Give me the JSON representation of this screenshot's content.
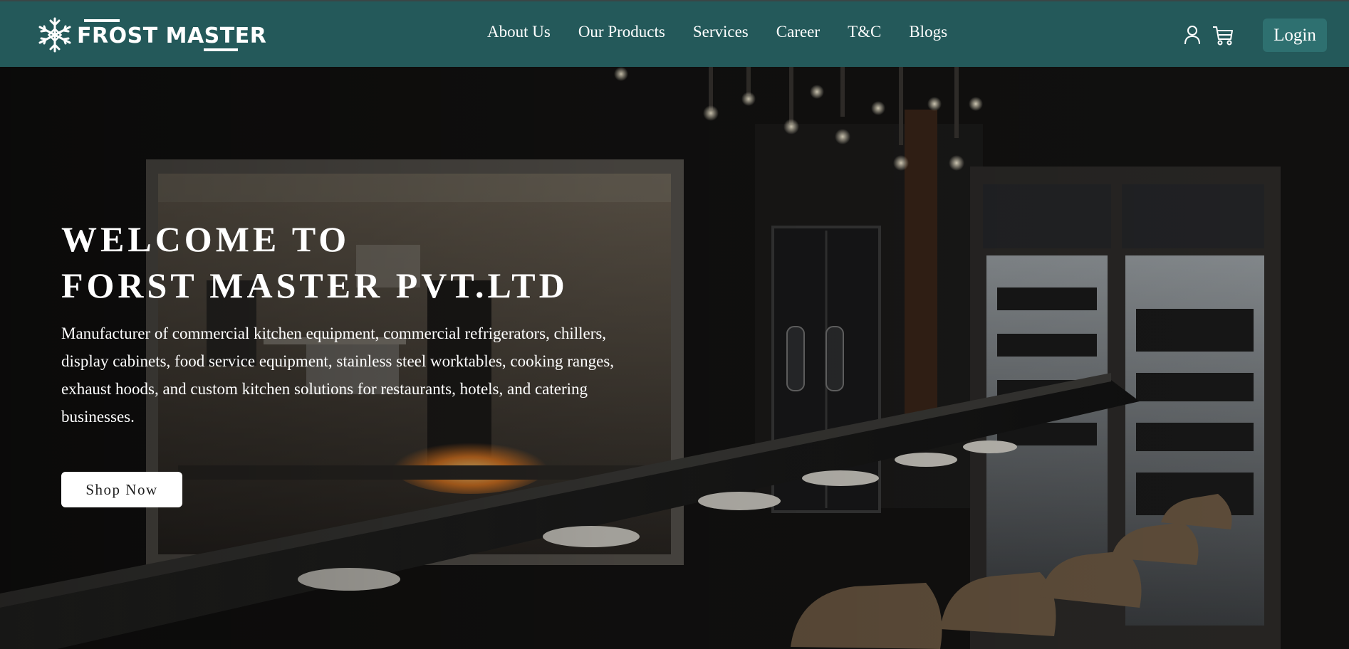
{
  "brand": {
    "name": "FROST MASTER",
    "logo_icon": "snowflake-icon"
  },
  "nav": {
    "links": [
      {
        "label": "About Us"
      },
      {
        "label": "Our Products"
      },
      {
        "label": "Services"
      },
      {
        "label": "Career"
      },
      {
        "label": "T&C"
      },
      {
        "label": "Blogs"
      }
    ],
    "user_icon": "user-icon",
    "cart_icon": "cart-icon",
    "login_label": "Login"
  },
  "hero": {
    "title_line1": "WELCOME TO",
    "title_line2": "FORST MASTER PVT.LTD",
    "description": "Manufacturer of commercial kitchen equipment, commercial refrigerators, chillers, display cabinets, food service equipment, stainless steel worktables, cooking ranges, exhaust hoods, and custom kitchen solutions for restaurants, hotels, and catering businesses.",
    "cta_label": "Shop Now"
  },
  "colors": {
    "navbar": "#24595a",
    "login_button": "#2e7070",
    "hero_text": "#ffffff",
    "cta_background": "#ffffff"
  }
}
